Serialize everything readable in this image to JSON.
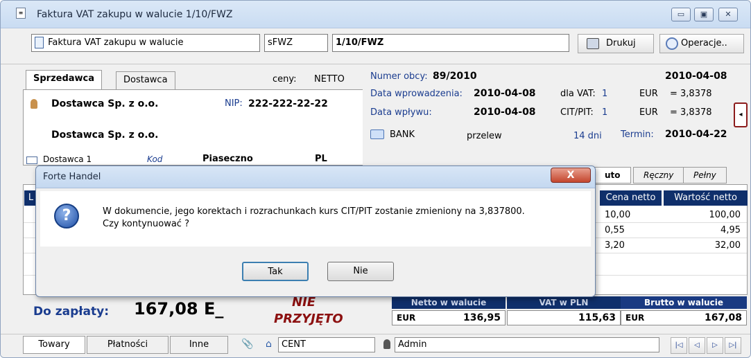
{
  "window": {
    "title": "Faktura VAT zakupu w walucie 1/10/FWZ",
    "controls": {
      "minimize": "▭",
      "maximize": "▣",
      "close": "✕"
    }
  },
  "toolbar": {
    "doc_type": "Faktura VAT zakupu w walucie",
    "doc_symbol": "sFWZ",
    "doc_number": "1/10/FWZ",
    "print_label": "Drukuj",
    "operations_label": "Operacje.."
  },
  "left_panel": {
    "tabs": [
      "Sprzedawca",
      "Dostawca"
    ],
    "prices_label": "ceny:",
    "prices_value": "NETTO",
    "supplier_name": "Dostawca Sp. z o.o.",
    "nip_label": "NIP:",
    "nip_value": "222-222-22-22",
    "supplier_name2": "Dostawca Sp. z o.o.",
    "address_partial": "Dostawca 1",
    "postal_partial": "Kod",
    "city": "Piaseczno",
    "country": "PL"
  },
  "right_panel": {
    "foreign_number_label": "Numer obcy:",
    "foreign_number": "89/2010",
    "doc_date": "2010-04-08",
    "entry_date_label": "Data wprowadzenia:",
    "entry_date": "2010-04-08",
    "vat_label": "dla VAT:",
    "vat_value": "1",
    "currency1": "EUR",
    "rate1": "= 3,8378",
    "receipt_date_label": "Data wpływu:",
    "receipt_date": "2010-04-08",
    "cit_label": "CIT/PIT:",
    "cit_value": "1",
    "currency2": "EUR",
    "rate2": "= 3,8378",
    "payment_method": "BANK",
    "payment_type": "przelew",
    "payment_days": "14 dni",
    "due_label": "Termin:",
    "due_date": "2010-04-22",
    "collapse_icon": "◂"
  },
  "grid": {
    "view_tabs": [
      "uto",
      "Ręczny",
      "Pełny"
    ],
    "first_header_partial": "L",
    "col_price": "Cena netto",
    "col_value": "Wartość netto",
    "rows": [
      {
        "price": "10,00",
        "value": "100,00"
      },
      {
        "price": "0,55",
        "value": "4,95"
      },
      {
        "price": "3,20",
        "value": "32,00"
      }
    ]
  },
  "totals": {
    "to_pay_label": "Do zapłaty:",
    "to_pay_value": "167,08 E_",
    "stamp_line1": "NIE",
    "stamp_line2": "PRZYJĘTO",
    "netto_header": "Netto w walucie",
    "vat_header": "VAT w PLN",
    "brutto_header": "Brutto w walucie",
    "netto_currency": "EUR",
    "netto_value": "136,95",
    "vat_value": "115,63",
    "brutto_currency": "EUR",
    "brutto_value": "167,08"
  },
  "statusbar": {
    "tabs": [
      "Towary",
      "Płatności",
      "Inne"
    ],
    "cent": "CENT",
    "user": "Admin",
    "nav": [
      "|◁",
      "◁",
      "▷",
      "▷|"
    ]
  },
  "dialog": {
    "title": "Forte Handel",
    "close_icon": "X",
    "question_icon": "?",
    "message_line1": "W dokumencie, jego korektach i rozrachunkach kurs CIT/PIT zostanie zmieniony na 3,837800.",
    "message_line2": "Czy kontynuować ?",
    "yes_label": "Tak",
    "no_label": "Nie"
  }
}
